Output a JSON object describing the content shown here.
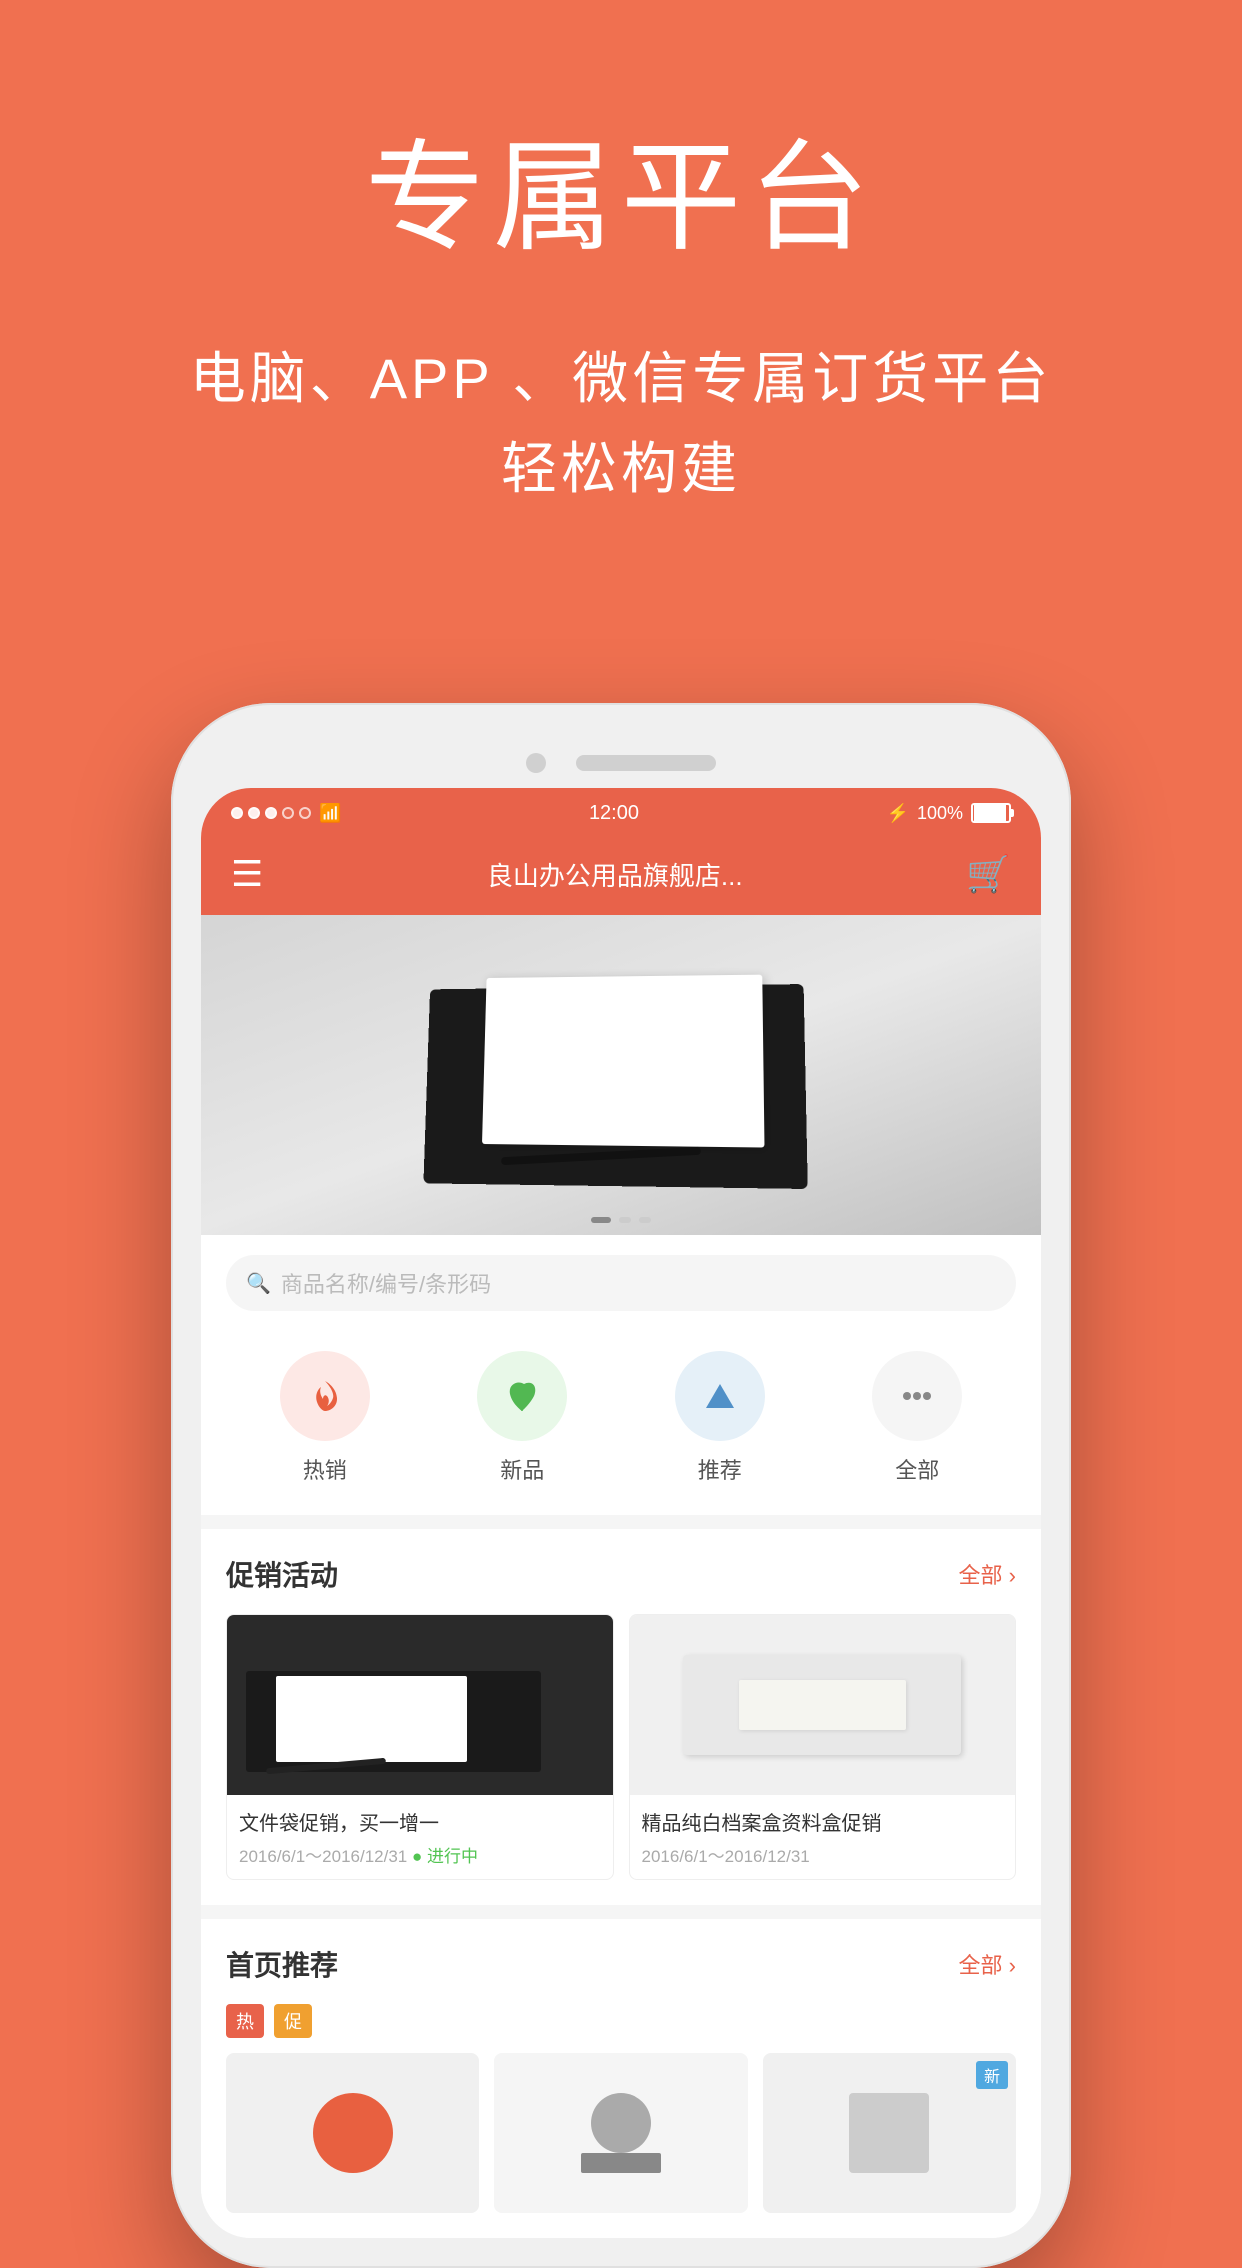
{
  "page": {
    "background_color": "#F07050",
    "main_title": "专属平台",
    "subtitle_line1": "电脑、APP 、微信专属订货平台",
    "subtitle_line2": "轻松构建"
  },
  "phone": {
    "status_bar": {
      "time": "12:00",
      "battery_percent": "100%"
    },
    "nav_bar": {
      "title": "良山办公用品旗舰店...",
      "dropdown_hint": "▾"
    },
    "search": {
      "placeholder": "商品名称/编号/条形码"
    },
    "categories": [
      {
        "id": "hot",
        "label": "热销",
        "icon_type": "flame"
      },
      {
        "id": "new",
        "label": "新品",
        "icon_type": "leaf"
      },
      {
        "id": "rec",
        "label": "推荐",
        "icon_type": "triangle"
      },
      {
        "id": "all",
        "label": "全部",
        "icon_type": "dots"
      }
    ],
    "promo_section": {
      "title": "促销活动",
      "more_label": "全部 ›",
      "items": [
        {
          "title": "文件袋促销，买一增一",
          "date": "2016/6/1～2016/12/31",
          "status": "● 进行中"
        },
        {
          "title": "精品纯白档案盒资料盒促销",
          "date": "2016/6/1～2016/12/31",
          "status": "● ›"
        }
      ]
    },
    "recommend_section": {
      "title": "首页推荐",
      "more_label": "全部 ›",
      "tags": [
        "热",
        "促",
        "新"
      ]
    }
  }
}
